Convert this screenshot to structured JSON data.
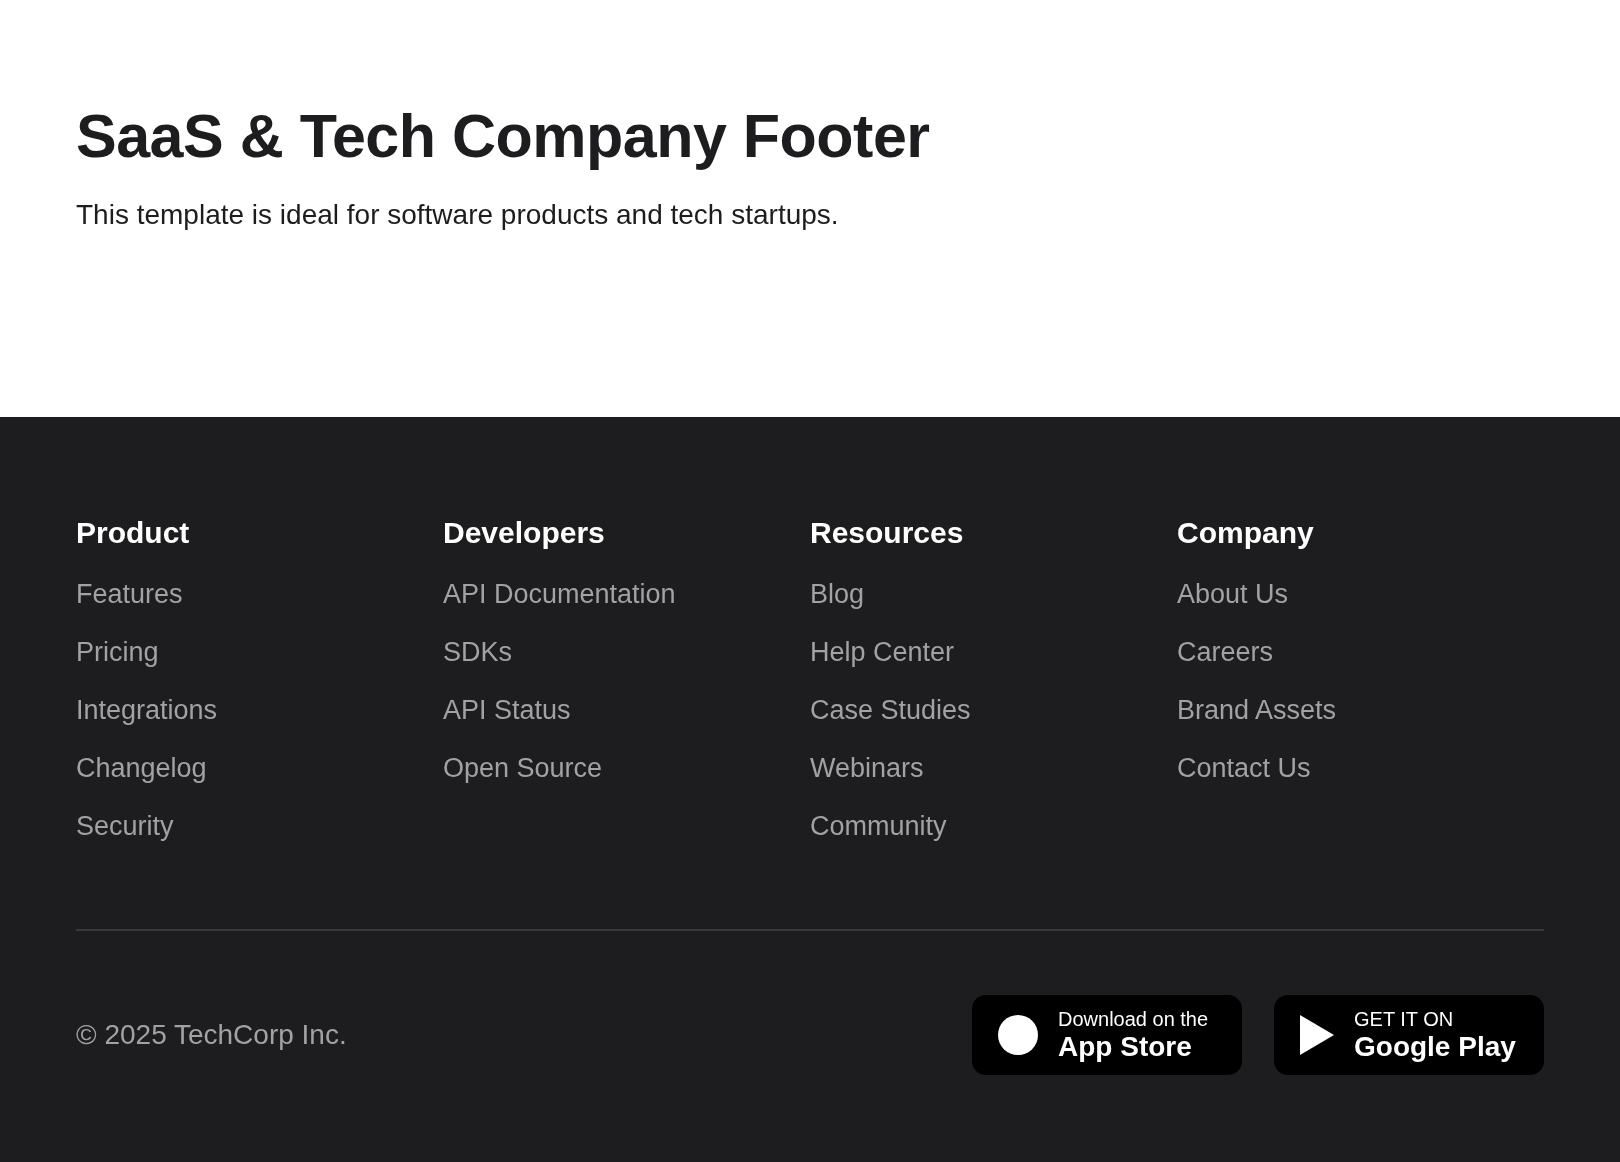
{
  "header": {
    "title": "SaaS & Tech Company Footer",
    "description": "This template is ideal for software products and tech startups."
  },
  "footer": {
    "columns": [
      {
        "heading": "Product",
        "links": [
          "Features",
          "Pricing",
          "Integrations",
          "Changelog",
          "Security"
        ]
      },
      {
        "heading": "Developers",
        "links": [
          "API Documentation",
          "SDKs",
          "API Status",
          "Open Source"
        ]
      },
      {
        "heading": "Resources",
        "links": [
          "Blog",
          "Help Center",
          "Case Studies",
          "Webinars",
          "Community"
        ]
      },
      {
        "heading": "Company",
        "links": [
          "About Us",
          "Careers",
          "Brand Assets",
          "Contact Us"
        ]
      }
    ],
    "copyright": "© 2025 TechCorp Inc.",
    "store_badges": [
      {
        "kind": "apple",
        "small_text": "Download on the",
        "large_text": "App Store"
      },
      {
        "kind": "google",
        "small_text": "GET IT ON",
        "large_text": "Google Play"
      }
    ]
  }
}
